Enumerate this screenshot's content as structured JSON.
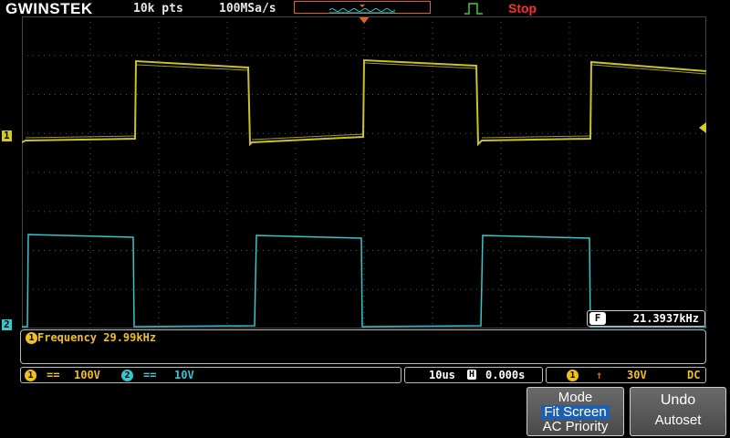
{
  "header": {
    "brand": "GWINSTEK",
    "record_length": "10k pts",
    "sample_rate": "100MSa/s",
    "trigger_state": "Stop"
  },
  "channels": {
    "ch1": {
      "marker": "1",
      "color": "#d6c92a",
      "scale": "100V"
    },
    "ch2": {
      "marker": "2",
      "color": "#35c6d0",
      "scale": "10V"
    }
  },
  "frequency_readout": {
    "icon": "F",
    "value": "21.3937kHz"
  },
  "measurement": {
    "label": "Frequency 29.99kHz",
    "source": "1"
  },
  "timebase": {
    "scale": "10us",
    "position_icon": "H",
    "position": "0.000s"
  },
  "trigger": {
    "source": "1",
    "level": "30V",
    "coupling": "DC"
  },
  "softkeys": {
    "mode": {
      "title": "Mode",
      "option1": "Fit Screen",
      "option2": "AC Priority"
    },
    "undo": {
      "line1": "Undo",
      "line2": "Autoset"
    }
  },
  "colors": {
    "grid": "#5a5a5a",
    "trigger_orange": "#e0641e",
    "stop_red": "#ff3030",
    "meas_yellow": "#f0c020"
  }
}
